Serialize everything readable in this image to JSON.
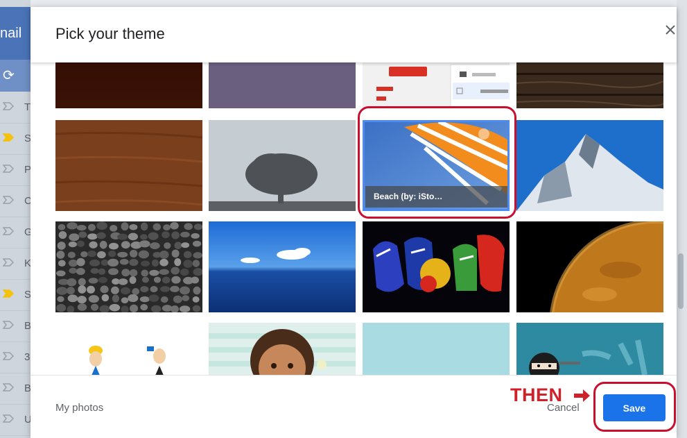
{
  "background": {
    "app_label": "nail",
    "refresh_icon": "refresh-icon",
    "rows": [
      {
        "letter": "T",
        "tag": "outline"
      },
      {
        "letter": "S",
        "tag": "yellow"
      },
      {
        "letter": "P",
        "tag": "outline"
      },
      {
        "letter": "C",
        "tag": "outline"
      },
      {
        "letter": "G",
        "tag": "outline"
      },
      {
        "letter": "K",
        "tag": "outline"
      },
      {
        "letter": "S",
        "tag": "yellow"
      },
      {
        "letter": "B",
        "tag": "outline"
      },
      {
        "letter": "3",
        "tag": "outline"
      },
      {
        "letter": "B",
        "tag": "outline"
      },
      {
        "letter": "U",
        "tag": "outline"
      }
    ]
  },
  "modal": {
    "title": "Pick your theme",
    "close_icon": "close-icon",
    "themes": [
      {
        "name": "dark-wood-red",
        "selected": false
      },
      {
        "name": "purple-solid",
        "selected": false
      },
      {
        "name": "gmail-ui",
        "selected": false
      },
      {
        "name": "dark-wood-planks",
        "selected": false
      },
      {
        "name": "brown-wood",
        "selected": false
      },
      {
        "name": "tree",
        "selected": false
      },
      {
        "name": "beach",
        "selected": true,
        "caption": "Beach (by: iSto…"
      },
      {
        "name": "mountain",
        "selected": false
      },
      {
        "name": "pebbles",
        "selected": false
      },
      {
        "name": "ocean",
        "selected": false
      },
      {
        "name": "graffiti",
        "selected": false
      },
      {
        "name": "planet",
        "selected": false
      },
      {
        "name": "cartoon-characters",
        "selected": false
      },
      {
        "name": "cartoon-girl",
        "selected": false
      },
      {
        "name": "light-blue",
        "selected": false
      },
      {
        "name": "ninja",
        "selected": false
      }
    ],
    "footer": {
      "my_photos": "My photos",
      "cancel": "Cancel",
      "save": "Save"
    }
  },
  "annotation": {
    "then_text": "THEN",
    "arrow_icon": "right-arrow-icon",
    "highlight_color": "#c8102e"
  },
  "colors": {
    "accent": "#1a73e8",
    "selection": "#4c8bf5"
  }
}
